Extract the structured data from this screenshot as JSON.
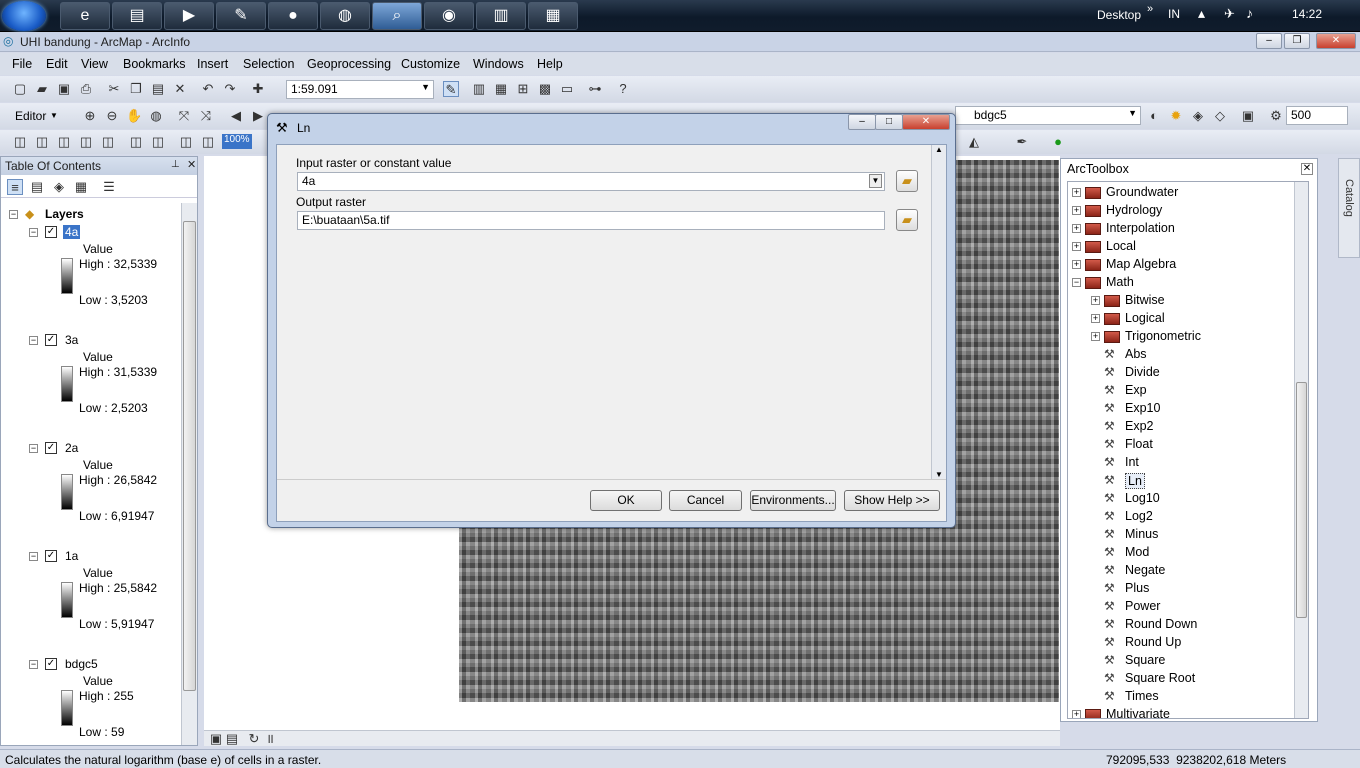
{
  "taskbar": {
    "desktop_label": "Desktop",
    "lang": "IN",
    "time": "14:22"
  },
  "window": {
    "title": "UHI bandung - ArcMap - ArcInfo"
  },
  "menu": [
    "File",
    "Edit",
    "View",
    "Bookmarks",
    "Insert",
    "Selection",
    "Geoprocessing",
    "Customize",
    "Windows",
    "Help"
  ],
  "toolbar": {
    "scale": "1:59.091",
    "editor_label": "Editor",
    "zoom_pct": "100%",
    "layer_select": "bdgc5",
    "value_500": "500"
  },
  "toc": {
    "title": "Table Of Contents",
    "root": "Layers",
    "layers": [
      {
        "name": "4a",
        "value_label": "Value",
        "high": "High : 32,5339",
        "low": "Low : 3,5203"
      },
      {
        "name": "3a",
        "value_label": "Value",
        "high": "High : 31,5339",
        "low": "Low : 2,5203"
      },
      {
        "name": "2a",
        "value_label": "Value",
        "high": "High : 26,5842",
        "low": "Low : 6,91947"
      },
      {
        "name": "1a",
        "value_label": "Value",
        "high": "High : 25,5842",
        "low": "Low : 5,91947"
      },
      {
        "name": "bdgc5",
        "value_label": "Value",
        "high": "High : 255",
        "low": "Low : 59"
      }
    ]
  },
  "arctoolbox": {
    "title": "ArcToolbox",
    "catalog_label": "Catalog",
    "toolsets": [
      "Groundwater",
      "Hydrology",
      "Interpolation",
      "Local",
      "Map Algebra",
      "Math"
    ],
    "math_toolsets": [
      "Bitwise",
      "Logical",
      "Trigonometric"
    ],
    "math_tools": [
      "Abs",
      "Divide",
      "Exp",
      "Exp10",
      "Exp2",
      "Float",
      "Int",
      "Ln",
      "Log10",
      "Log2",
      "Minus",
      "Mod",
      "Negate",
      "Plus",
      "Power",
      "Round Down",
      "Round Up",
      "Square",
      "Square Root",
      "Times"
    ],
    "after": "Multivariate"
  },
  "dialog": {
    "title": "Ln",
    "input_label": "Input raster or constant value",
    "input_value": "4a",
    "output_label": "Output raster",
    "output_value": "E:\\buataan\\5a.tif",
    "ok": "OK",
    "cancel": "Cancel",
    "environments": "Environments...",
    "show_help": "Show Help >>"
  },
  "status": {
    "message": "Calculates the natural logarithm (base e) of cells in a raster.",
    "coords": "792095,533  9238202,618 Meters"
  }
}
